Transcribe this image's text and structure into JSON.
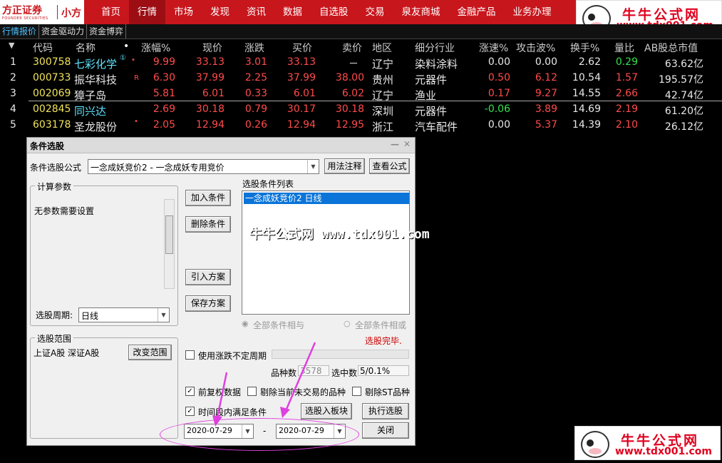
{
  "brand": {
    "name": "方正证券",
    "sub_en": "FOUNDER SECURITIES",
    "product": "小方"
  },
  "nav": [
    "首页",
    "行情",
    "市场",
    "发现",
    "资讯",
    "数据",
    "自选股",
    "交易",
    "泉友商城",
    "金融产品",
    "业务办理"
  ],
  "subtabs": [
    "行情报价",
    "资金驱动力",
    "资金博弈"
  ],
  "headers": {
    "arrow": "▼",
    "code": "代码",
    "name": "名称",
    "dot": "•",
    "chg_pct": "涨幅%",
    "price": "现价",
    "chg": "涨跌",
    "bid": "买价",
    "ask": "卖价",
    "region": "地区",
    "industry": "细分行业",
    "speed": "涨速%",
    "wave": "攻击波%",
    "turnover": "换手%",
    "vol_ratio": "量比",
    "mktcap": "AB股总市值"
  },
  "rows": [
    {
      "idx": "1",
      "code": "300758",
      "name": "七彩化学",
      "mark": "①",
      "flag": "•",
      "chg_pct": "9.99",
      "price": "33.13",
      "chg": "3.01",
      "bid": "33.13",
      "ask": "－",
      "region": "辽宁",
      "industry": "染料涂料",
      "speed": "0.00",
      "wave": "0.00",
      "turnover": "2.62",
      "vol_ratio": "0.29",
      "mktcap": "63.62亿"
    },
    {
      "idx": "2",
      "code": "000733",
      "name": "振华科技",
      "mark": "",
      "flag": "R",
      "chg_pct": "6.30",
      "price": "37.99",
      "chg": "2.25",
      "bid": "37.99",
      "ask": "38.00",
      "region": "贵州",
      "industry": "元器件",
      "speed": "0.50",
      "wave": "6.12",
      "turnover": "10.54",
      "vol_ratio": "1.57",
      "mktcap": "195.57亿"
    },
    {
      "idx": "3",
      "code": "002069",
      "name": "獐子岛",
      "mark": "",
      "flag": "",
      "chg_pct": "5.81",
      "price": "6.01",
      "chg": "0.33",
      "bid": "6.01",
      "ask": "6.02",
      "region": "辽宁",
      "industry": "渔业",
      "speed": "0.17",
      "wave": "9.27",
      "turnover": "14.55",
      "vol_ratio": "2.66",
      "mktcap": "42.74亿"
    },
    {
      "idx": "4",
      "code": "002845",
      "name": "同兴达",
      "mark": "",
      "flag": "",
      "chg_pct": "2.69",
      "price": "30.18",
      "chg": "0.79",
      "bid": "30.17",
      "ask": "30.18",
      "region": "深圳",
      "industry": "元器件",
      "speed": "-0.06",
      "wave": "3.89",
      "turnover": "14.69",
      "vol_ratio": "2.19",
      "mktcap": "61.20亿"
    },
    {
      "idx": "5",
      "code": "603178",
      "name": "圣龙股份",
      "mark": "",
      "flag": "•",
      "chg_pct": "2.05",
      "price": "12.94",
      "chg": "0.26",
      "bid": "12.94",
      "ask": "12.95",
      "region": "浙江",
      "industry": "汽车配件",
      "speed": "0.00",
      "wave": "5.37",
      "turnover": "14.39",
      "vol_ratio": "2.10",
      "mktcap": "26.12亿"
    }
  ],
  "dialog": {
    "title": "条件选股",
    "formula_label": "条件选股公式",
    "formula_value": "一念成妖竞价2 - 一念成妖专用竞价",
    "btn_usage": "用法注释",
    "btn_view": "查看公式",
    "params_group": "计算参数",
    "params_text": "无参数需要设置",
    "period_label": "选股周期:",
    "period_value": "日线",
    "range_group": "选股范围",
    "range_text": "上证A股  深证A股",
    "btn_change_range": "改变范围",
    "btn_add": "加入条件",
    "btn_del": "删除条件",
    "btn_import": "引入方案",
    "btn_save": "保存方案",
    "list_label": "选股条件列表",
    "list_item": "一念成妖竞价2   日线",
    "radio_and": "全部条件相与",
    "radio_or": "全部条件相或",
    "status": "选股完毕.",
    "chk_uncertain": "使用涨跌不定周期",
    "count_label": "品种数",
    "count_value": "3578",
    "hit_label": "选中数",
    "hit_value": "5/0.1%",
    "chk_fq": "前复权数据",
    "chk_exclude_notrade": "剔除当前未交易的品种",
    "chk_exclude_st": "剔除ST品种",
    "chk_time": "时间段内满足条件",
    "btn_to_block": "选股入板块",
    "btn_run": "执行选股",
    "date_from": "2020-07-29",
    "date_sep": "-",
    "date_to": "2020-07-29",
    "btn_close": "关闭"
  },
  "watermark": {
    "cn": "牛牛公式网",
    "url": "www.tdx001.com",
    "mid": "牛牛公式网 www.tdx001.com"
  },
  "colors": {
    "topbar": "#c8161d",
    "up": "#ff4b4b",
    "down": "#34e34a",
    "code": "#f0e35a",
    "highlight": "#e040e0"
  }
}
